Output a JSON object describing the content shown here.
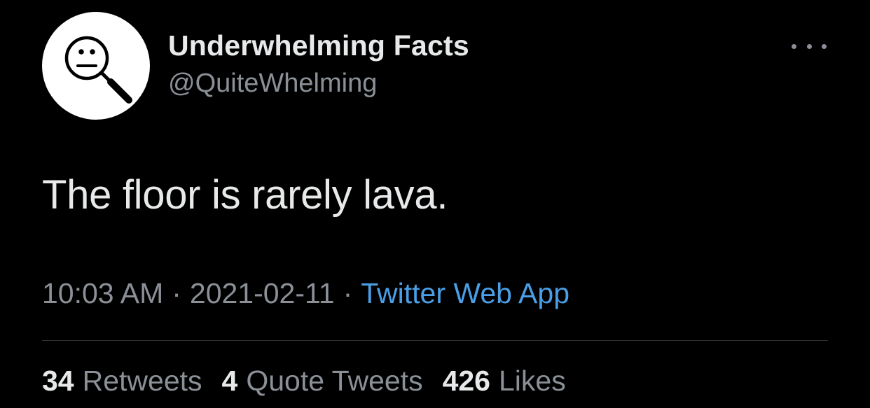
{
  "author": {
    "display_name": "Underwhelming Facts",
    "handle": "@QuiteWhelming",
    "avatar_icon": "neutral-face-magnifier-icon"
  },
  "tweet": {
    "text": "The floor is rarely lava."
  },
  "meta": {
    "time": "10:03 AM",
    "separator": "·",
    "date": "2021-02-11",
    "source": "Twitter Web App"
  },
  "stats": {
    "retweets": {
      "count": "34",
      "label": "Retweets"
    },
    "quote_tweets": {
      "count": "4",
      "label": "Quote Tweets"
    },
    "likes": {
      "count": "426",
      "label": "Likes"
    }
  },
  "menu": {
    "icon": "more-horizontal-icon"
  },
  "colors": {
    "background": "#000000",
    "primary_text": "#e7e9ea",
    "secondary_text": "#8b9097",
    "link": "#4a9fe6",
    "divider": "#2f3336"
  }
}
